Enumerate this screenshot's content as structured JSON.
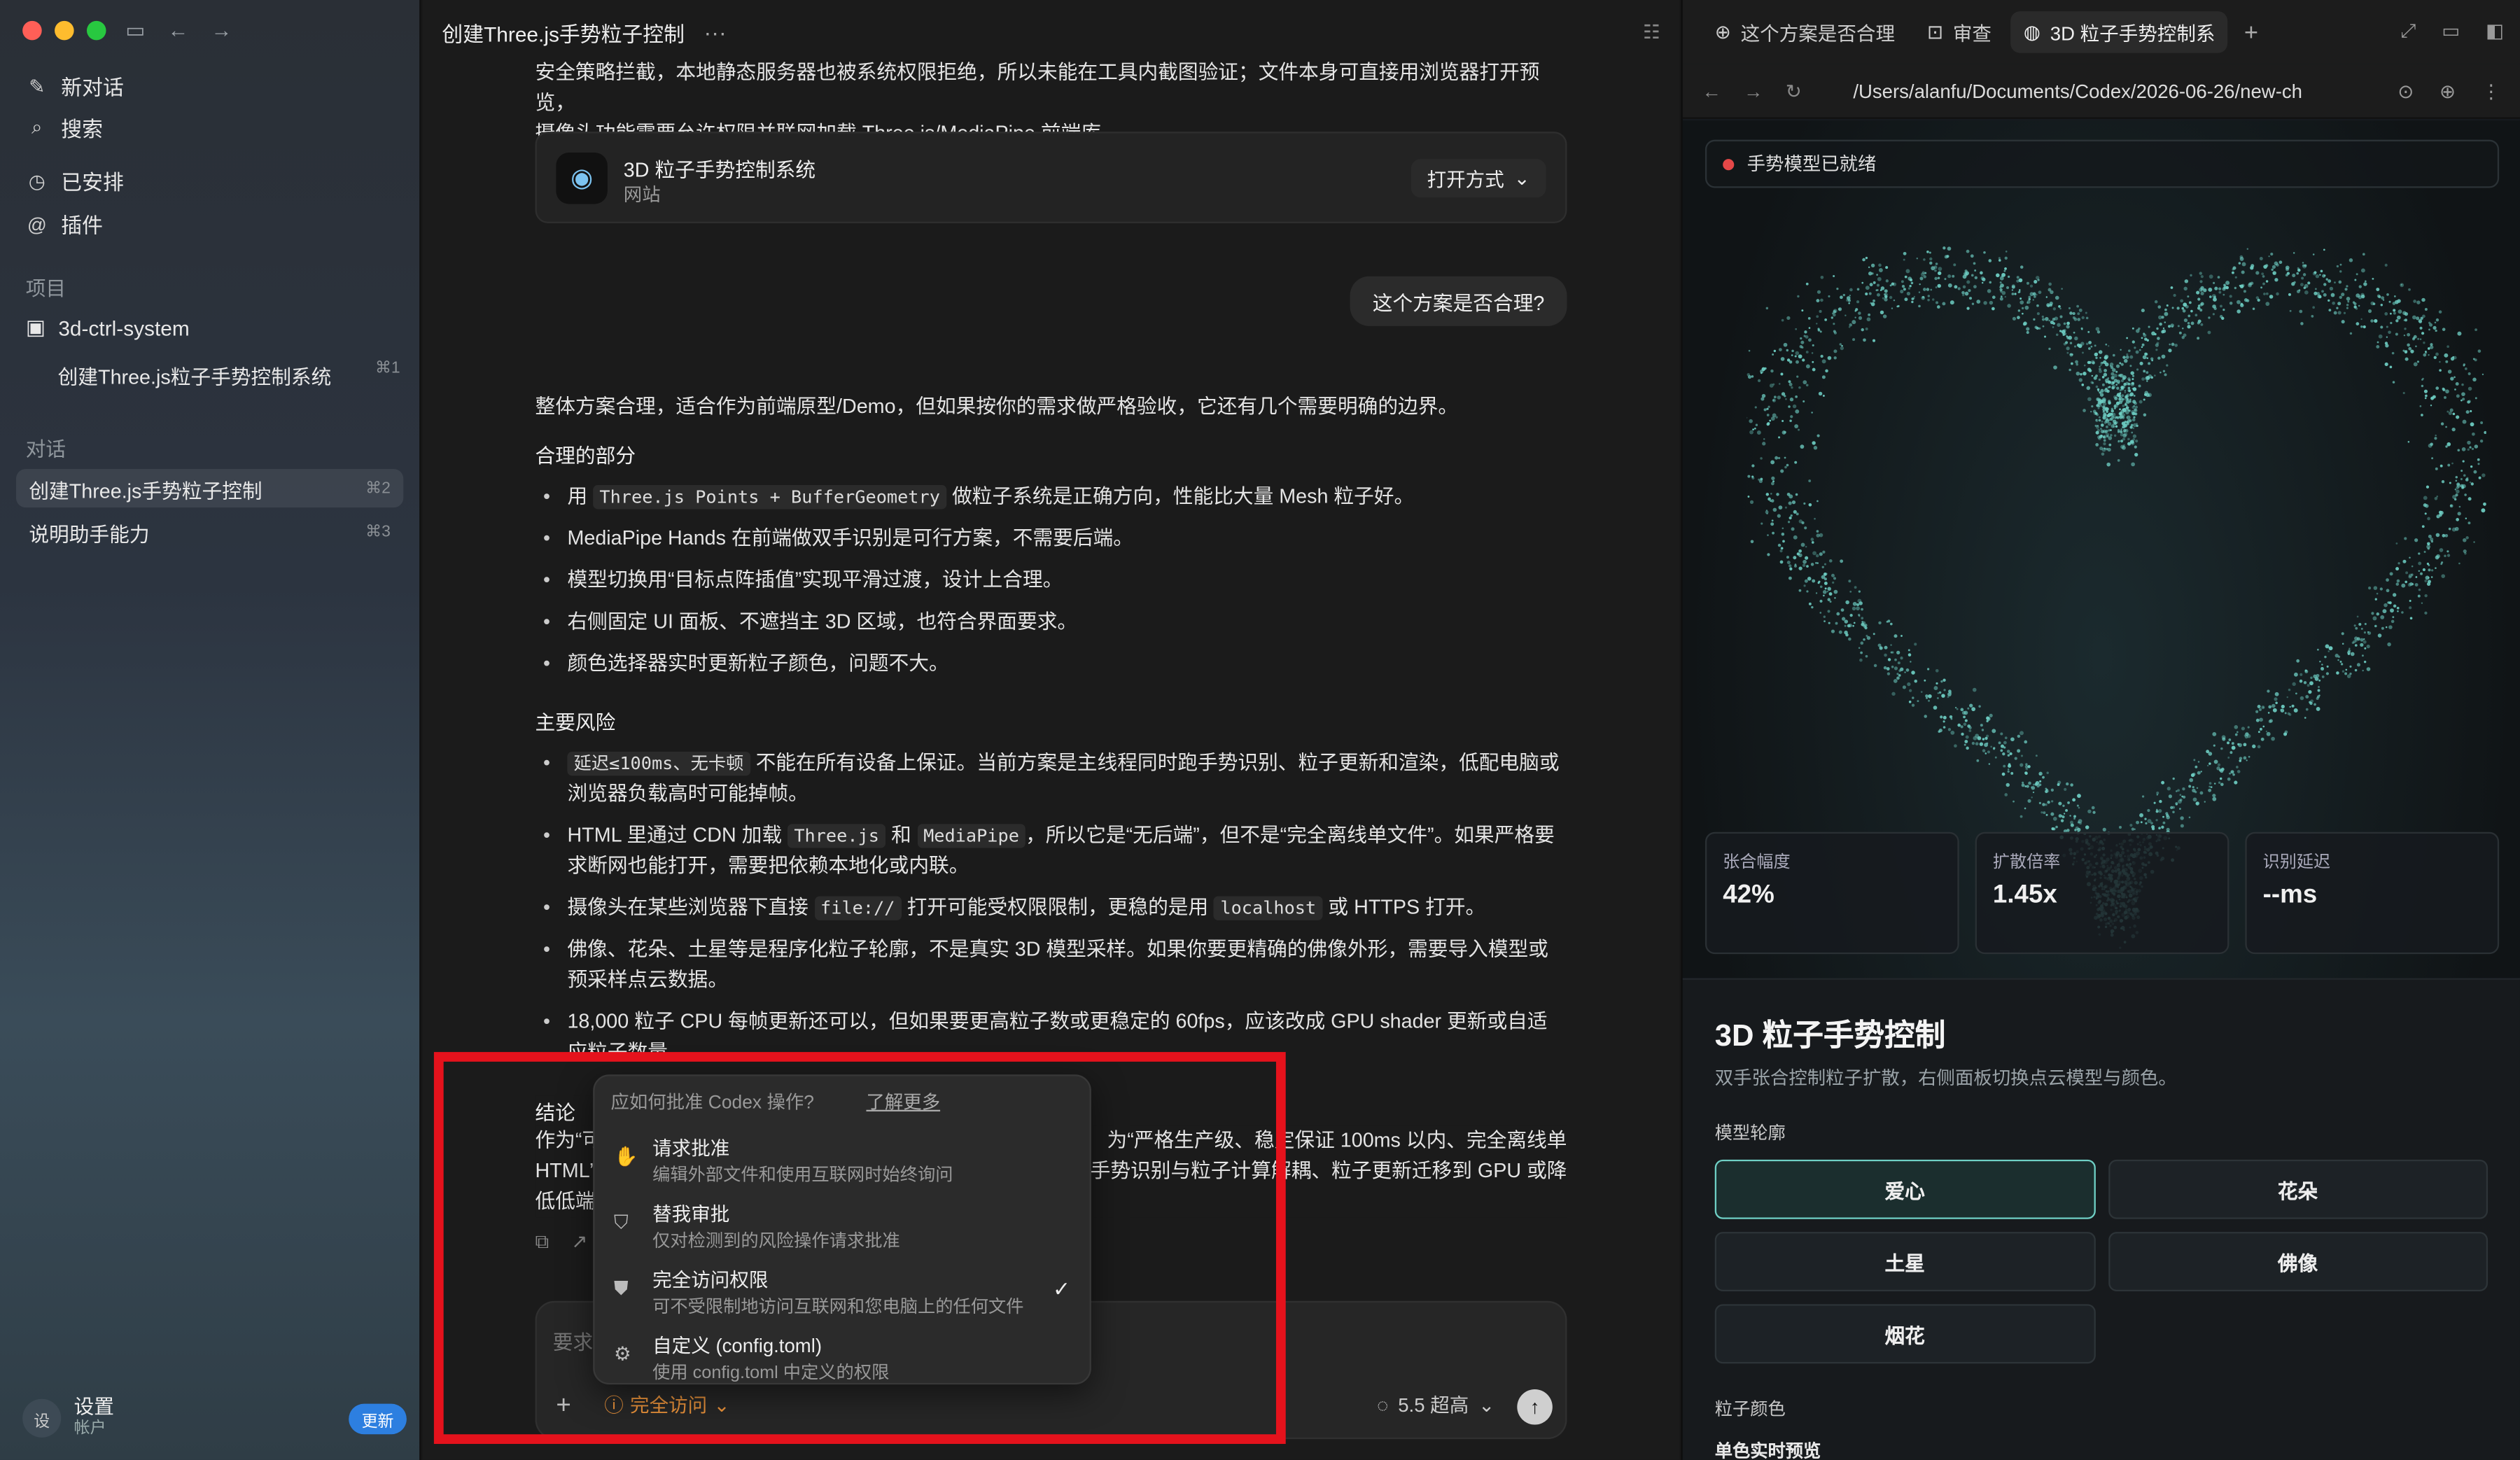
{
  "window": {
    "title": "创建Three.js手势粒子控制"
  },
  "sidebar": {
    "new_chat": "新对话",
    "search": "搜索",
    "scheduled": "已安排",
    "plugins": "插件",
    "projects_label": "项目",
    "project_name": "3d-ctrl-system",
    "project_thread": {
      "label": "创建Three.js粒子手势控制系统",
      "kbd": "⌘1"
    },
    "conversations_label": "对话",
    "conversations": [
      {
        "label": "创建Three.js手势粒子控制",
        "kbd": "⌘2"
      },
      {
        "label": "说明助手能力",
        "kbd": "⌘3"
      }
    ],
    "settings": {
      "avatar": "设",
      "title": "设置",
      "sub": "帐户",
      "update": "更新"
    }
  },
  "chat": {
    "intro_line1": "安全策略拦截，本地静态服务器也被系统权限拒绝，所以未能在工具内截图验证；文件本身可直接用浏览器打开预览，",
    "intro_line2": "摄像头功能需要允许权限并联网加载 Three.js/MediaPipe 前端库。",
    "site_card": {
      "name": "3D 粒子手势控制系统",
      "type": "网站",
      "open": "打开方式"
    },
    "user_question": "这个方案是否合理?",
    "answer_intro": "整体方案合理，适合作为前端原型/Demo，但如果按你的需求做严格验收，它还有几个需要明确的边界。",
    "reasonable_heading": "合理的部分",
    "reasonable": {
      "b1_pre": "用",
      "b1_code": "Three.js Points + BufferGeometry",
      "b1_post": "做粒子系统是正确方向，性能比大量 Mesh 粒子好。",
      "b2": "MediaPipe Hands 在前端做双手识别是可行方案，不需要后端。",
      "b3": "模型切换用“目标点阵插值”实现平滑过渡，设计上合理。",
      "b4": "右侧固定 UI 面板、不遮挡主 3D 区域，也符合界面要求。",
      "b5": "颜色选择器实时更新粒子颜色，问题不大。"
    },
    "risk_heading": "主要风险",
    "risks": {
      "r1_code": "延迟≤100ms、无卡顿",
      "r1_post": "不能在所有设备上保证。当前方案是主线程同时跑手势识别、粒子更新和渲染，低配电脑或浏览器负载高时可能掉帧。",
      "r2_pre": "HTML 里通过 CDN 加载",
      "r2_code1": "Three.js",
      "r2_mid": "和",
      "r2_code2": "MediaPipe",
      "r2_post": "，所以它是“无后端”，但不是“完全离线单文件”。如果严格要求断网也能打开，需要把依赖本地化或内联。",
      "r3_pre": "摄像头在某些浏览器下直接",
      "r3_code1": "file://",
      "r3_mid": "打开可能受权限限制，更稳的是用",
      "r3_code2": "localhost",
      "r3_post": "或 HTTPS 打开。",
      "r4": "佛像、花朵、土星等是程序化粒子轮廓，不是真实 3D 模型采样。如果你要更精确的佛像外形，需要导入模型或预采样点云数据。",
      "r5": "18,000 粒子 CPU 每帧更新还可以，但如果要更高粒子数或更稳定的 60fps，应该改成 GPU shader 更新或自适应粒子数量。"
    },
    "conclusion_heading": "结论",
    "conclusion_l1a": "作为“可",
    "conclusion_l1b": "为“严格生产级、稳定保证 100ms 以内、完全离线单",
    "conclusion_l2a": "HTML”",
    "conclusion_l2b": "手势识别与粒子计算解耦、粒子更新迁移到 GPU 或降",
    "conclusion_l3": "低低端",
    "composer": {
      "placeholder": "要求后续变更",
      "access": "完全访问",
      "model": "5.5 超高"
    }
  },
  "approval_menu": {
    "heading": "应如何批准 Codex 操作?",
    "learn_more": "了解更多",
    "items": [
      {
        "title": "请求批准",
        "desc": "编辑外部文件和使用互联网时始终询问"
      },
      {
        "title": "替我审批",
        "desc": "仅对检测到的风险操作请求批准"
      },
      {
        "title": "完全访问权限",
        "desc": "可不受限制地访问互联网和您电脑上的任何文件",
        "checked": "✓"
      },
      {
        "title": "自定义 (config.toml)",
        "desc": "使用 config.toml 中定义的权限"
      }
    ]
  },
  "browser": {
    "tabs": [
      {
        "label": "这个方案是否合理"
      },
      {
        "label": "审查"
      },
      {
        "label": "3D 粒子手势控制系"
      }
    ],
    "url": "/Users/alanfu/Documents/Codex/2026-06-26/new-ch",
    "status": "手势模型已就绪",
    "metrics": [
      {
        "label": "张合幅度",
        "value": "42%"
      },
      {
        "label": "扩散倍率",
        "value": "1.45x"
      },
      {
        "label": "识别延迟",
        "value": "--ms"
      }
    ],
    "panel": {
      "title": "3D 粒子手势控制",
      "subtitle": "双手张合控制粒子扩散，右侧面板切换点云模型与颜色。",
      "shape_label": "模型轮廓",
      "shapes": [
        "爱心",
        "花朵",
        "土星",
        "佛像",
        "烟花"
      ],
      "color_label": "粒子颜色",
      "color_sub": "单色实时预览"
    }
  },
  "colors": {
    "accent_orange": "#e8913a",
    "particle": "#6fd0c5",
    "highlight": "#e5121c"
  }
}
